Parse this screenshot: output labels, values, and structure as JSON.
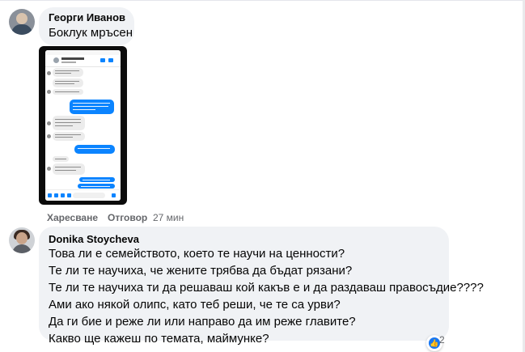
{
  "comments": [
    {
      "author": "Георги Иванов",
      "text": "Боклук мръсен",
      "actions": {
        "like": "Харесване",
        "reply": "Отговор",
        "time": "27 мин"
      }
    },
    {
      "author": "Donika Stoycheva",
      "lines": [
        "Това ли е семейството, което те научи на ценности?",
        "Те ли те научиха, че жените трябва да бъдат рязани?",
        "Те ли те научиха ти да решаваш кой какъв е и да раздаваш правосъдие????",
        "Ами ако някой олипс, като теб реши, че те са урви?",
        "Да ги бие и реже ли или направо да им реже главите?",
        "Какво ще кажеш по темата, маймунке?"
      ],
      "reactions": {
        "icon": "like-icon",
        "count": "2"
      }
    }
  ],
  "colors": {
    "bubble": "#f0f2f5",
    "action_text": "#65676b",
    "accent": "#1877f2",
    "messenger_blue": "#0b84ff"
  }
}
